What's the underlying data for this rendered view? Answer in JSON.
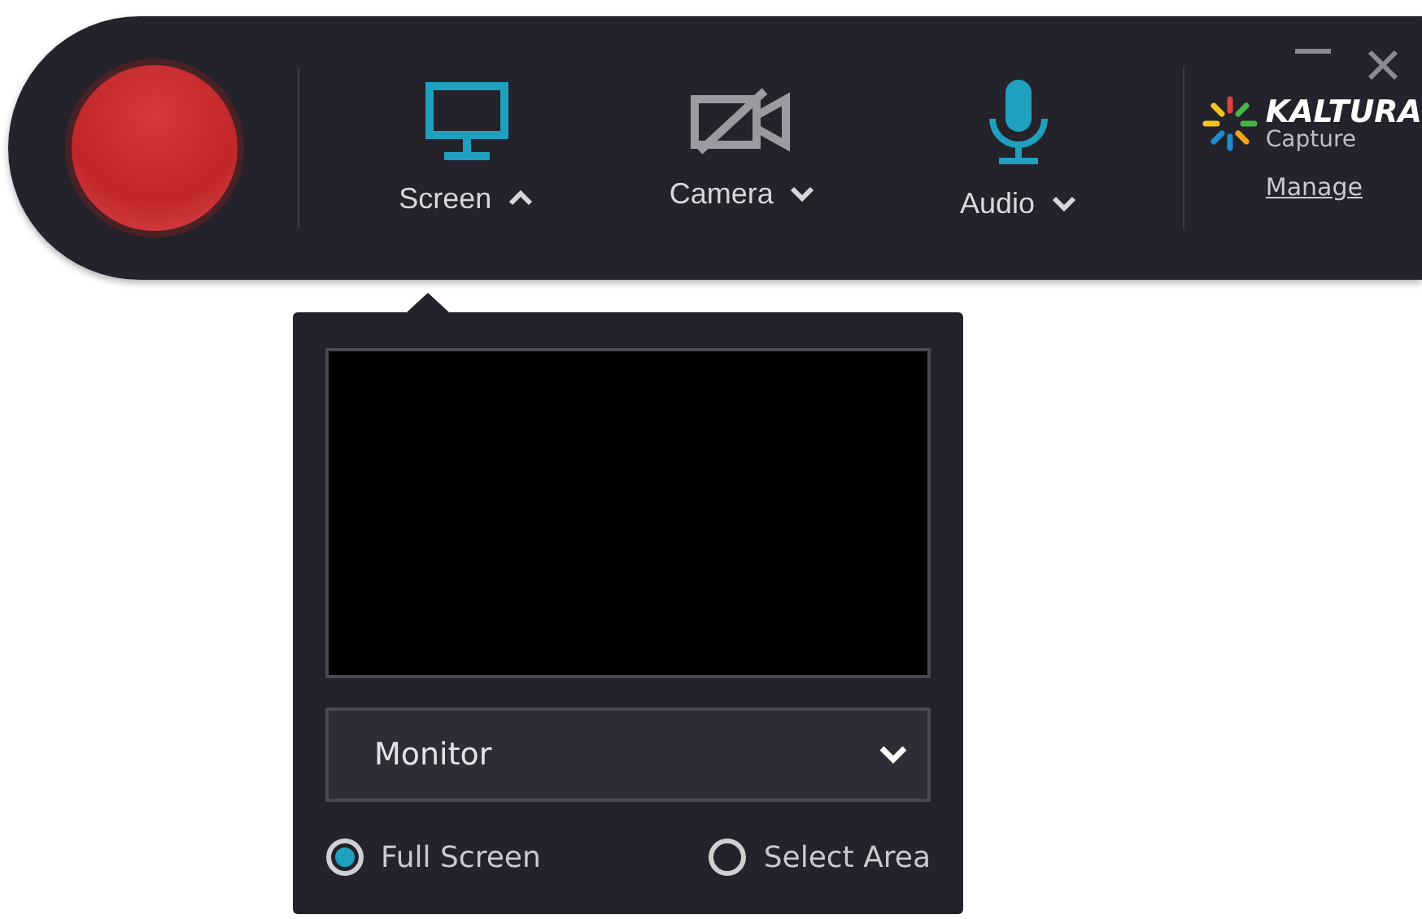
{
  "toolbar": {
    "sources": [
      {
        "kind": "screen",
        "label": "Screen",
        "on": true,
        "expanded": true
      },
      {
        "kind": "camera",
        "label": "Camera",
        "on": false,
        "expanded": false
      },
      {
        "kind": "audio",
        "label": "Audio",
        "on": true,
        "expanded": false
      }
    ],
    "logo": {
      "brand": "KALTURA",
      "product": "Capture"
    },
    "manage_link": "Manage"
  },
  "screen_panel": {
    "dropdown": {
      "value": "Monitor"
    },
    "options": [
      {
        "label": "Full Screen",
        "selected": true
      },
      {
        "label": "Select Area",
        "selected": false
      }
    ]
  }
}
